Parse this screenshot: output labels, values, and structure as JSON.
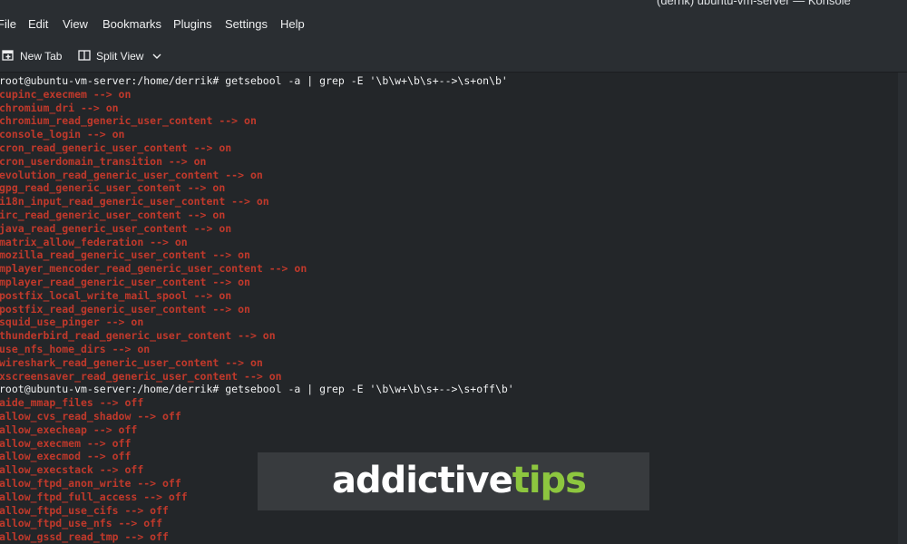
{
  "window": {
    "title": "(derrik) ubuntu-vm-server — Konsole"
  },
  "menubar": {
    "items": [
      "File",
      "Edit",
      "View",
      "Bookmarks",
      "Plugins",
      "Settings",
      "Help"
    ]
  },
  "toolbar": {
    "new_tab_label": "New Tab",
    "split_view_label": "Split View"
  },
  "terminal": {
    "lines": [
      {
        "kind": "prompt",
        "text": "root@ubuntu-vm-server:/home/derrik# getsebool -a | grep -E '\\b\\w+\\b\\s+-->\\s+on\\b'"
      },
      {
        "kind": "out",
        "text": "cupinc_execmem --> on"
      },
      {
        "kind": "out",
        "text": "chromium_dri --> on"
      },
      {
        "kind": "out",
        "text": "chromium_read_generic_user_content --> on"
      },
      {
        "kind": "out",
        "text": "console_login --> on"
      },
      {
        "kind": "out",
        "text": "cron_read_generic_user_content --> on"
      },
      {
        "kind": "out",
        "text": "cron_userdomain_transition --> on"
      },
      {
        "kind": "out",
        "text": "evolution_read_generic_user_content --> on"
      },
      {
        "kind": "out",
        "text": "gpg_read_generic_user_content --> on"
      },
      {
        "kind": "out",
        "text": "i18n_input_read_generic_user_content --> on"
      },
      {
        "kind": "out",
        "text": "irc_read_generic_user_content --> on"
      },
      {
        "kind": "out",
        "text": "java_read_generic_user_content --> on"
      },
      {
        "kind": "out",
        "text": "matrix_allow_federation --> on"
      },
      {
        "kind": "out",
        "text": "mozilla_read_generic_user_content --> on"
      },
      {
        "kind": "out",
        "text": "mplayer_mencoder_read_generic_user_content --> on"
      },
      {
        "kind": "out",
        "text": "mplayer_read_generic_user_content --> on"
      },
      {
        "kind": "out",
        "text": "postfix_local_write_mail_spool --> on"
      },
      {
        "kind": "out",
        "text": "postfix_read_generic_user_content --> on"
      },
      {
        "kind": "out",
        "text": "squid_use_pinger --> on"
      },
      {
        "kind": "out",
        "text": "thunderbird_read_generic_user_content --> on"
      },
      {
        "kind": "out",
        "text": "use_nfs_home_dirs --> on"
      },
      {
        "kind": "out",
        "text": "wireshark_read_generic_user_content --> on"
      },
      {
        "kind": "out",
        "text": "xscreensaver_read_generic_user_content --> on"
      },
      {
        "kind": "prompt",
        "text": "root@ubuntu-vm-server:/home/derrik# getsebool -a | grep -E '\\b\\w+\\b\\s+-->\\s+off\\b'"
      },
      {
        "kind": "out",
        "text": "aide_mmap_files --> off"
      },
      {
        "kind": "out",
        "text": "allow_cvs_read_shadow --> off"
      },
      {
        "kind": "out",
        "text": "allow_execheap --> off"
      },
      {
        "kind": "out",
        "text": "allow_execmem --> off"
      },
      {
        "kind": "out",
        "text": "allow_execmod --> off"
      },
      {
        "kind": "out",
        "text": "allow_execstack --> off"
      },
      {
        "kind": "out",
        "text": "allow_ftpd_anon_write --> off"
      },
      {
        "kind": "out",
        "text": "allow_ftpd_full_access --> off"
      },
      {
        "kind": "out",
        "text": "allow_ftpd_use_cifs --> off"
      },
      {
        "kind": "out",
        "text": "allow_ftpd_use_nfs --> off"
      },
      {
        "kind": "out",
        "text": "allow_gssd_read_tmp --> off"
      }
    ]
  },
  "watermark": {
    "part1": "addictive",
    "part2": "tips",
    "color_white": "#ffffff",
    "color_green": "#8dc63f"
  },
  "colors": {
    "terminal_bg": "#232629",
    "output_red": "#c0392b",
    "prompt_text": "#eff0f1",
    "chrome_bg": "#2a2e32"
  }
}
